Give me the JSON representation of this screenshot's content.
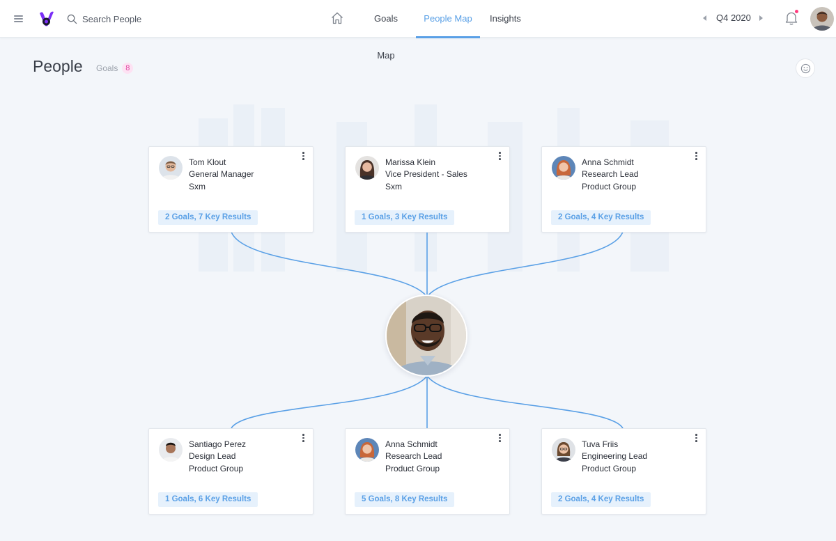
{
  "header": {
    "search_placeholder": "Search People",
    "nav": [
      {
        "label": "Goals Map"
      },
      {
        "label": "People Map"
      },
      {
        "label": "Insights"
      }
    ],
    "quarter": "Q4 2020",
    "colors": {
      "accent": "#5aa0e6",
      "notification": "#ff3d7f",
      "logo_primary": "#7b2ff7",
      "logo_dark": "#1a1a2e"
    },
    "icons": [
      "menu-icon",
      "logo-icon",
      "search-icon",
      "home-icon",
      "chevron-left-icon",
      "chevron-right-icon",
      "bell-icon"
    ]
  },
  "page": {
    "title": "People",
    "goals_tab_label": "Goals",
    "goals_count": "8",
    "icons": [
      "smiley-icon"
    ]
  },
  "managers": [
    {
      "name": "Tom Klout",
      "role": "General Manager",
      "group": "Sxm",
      "summary": "2 Goals, 7 Key Results"
    },
    {
      "name": "Marissa Klein",
      "role": "Vice President - Sales",
      "group": "Sxm",
      "summary": "1 Goals, 3 Key Results"
    },
    {
      "name": "Anna Schmidt",
      "role": "Research Lead",
      "group": "Product Group",
      "summary": "2 Goals, 4 Key Results"
    }
  ],
  "reports": [
    {
      "name": "Santiago Perez",
      "role": "Design Lead",
      "group": "Product Group",
      "summary": "1 Goals, 6 Key Results"
    },
    {
      "name": "Anna Schmidt",
      "role": "Research Lead",
      "group": "Product Group",
      "summary": "5 Goals, 8 Key Results"
    },
    {
      "name": "Tuva Friis",
      "role": "Engineering Lead",
      "group": "Product Group",
      "summary": "2 Goals, 4 Key Results"
    }
  ]
}
